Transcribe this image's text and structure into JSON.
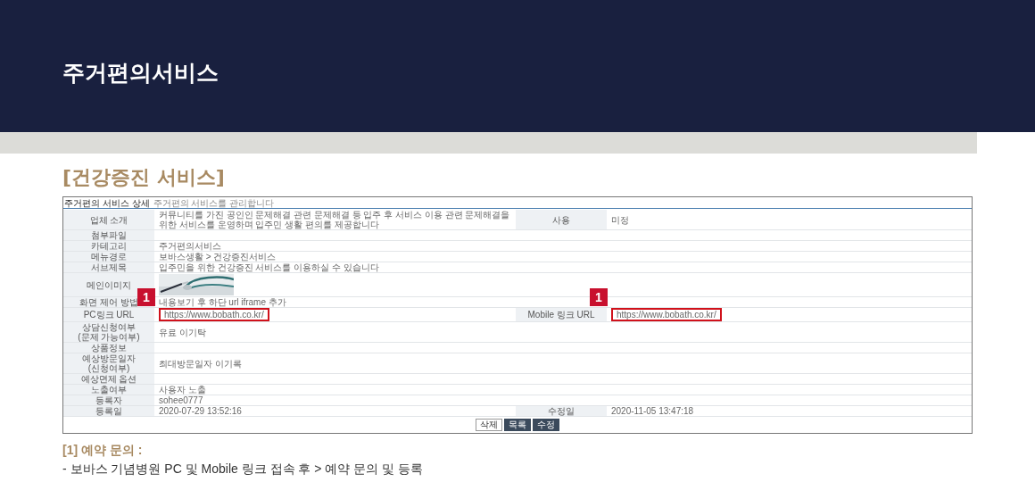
{
  "page_title": "주거편의서비스",
  "section_title": "[건강증진 서비스]",
  "screenshot": {
    "title": "주거편의 서비스 상세",
    "subtitle": "주거편의 서비스를 관리합니다",
    "rows": [
      {
        "kind": "text",
        "label": "업체 소개",
        "value": "커뮤니티를 가진 공인인 문제해결 관련 문제해결 등 입주 후 서비스 이용 관련 문제해결을 위한 서비스를 운영하며 입주민 생활 편의를 제공합니다",
        "right": {
          "label": "사용",
          "value": "미정"
        }
      },
      {
        "kind": "text",
        "label": "첨부파일",
        "value": ""
      },
      {
        "kind": "text",
        "label": "카테고리",
        "value": "주거편의서비스"
      },
      {
        "kind": "text",
        "label": "메뉴경로",
        "value": "보바스생활 > 건강증진서비스"
      },
      {
        "kind": "text",
        "label": "서브제목",
        "value": "입주민을 위한 건강증진 서비스를 이용하실 수 있습니다"
      },
      {
        "label": "메인이미지"
      },
      {
        "kind": "text",
        "label": "화면 제어 방법",
        "value": "내용보기 후 하단 url iframe 추가"
      },
      {
        "kind": "link",
        "label": "PC링크 URL",
        "value": "https://www.bobath.co.kr/",
        "marker": "1",
        "right": {
          "label": "Mobile 링크 URL",
          "value": "https://www.bobath.co.kr/",
          "marker": "1"
        }
      },
      {
        "kind": "text",
        "label": "상담신청여부\n(문제 가능여부)",
        "value": "유료 이기탁"
      },
      {
        "kind": "text",
        "label": "상품정보",
        "value": ""
      },
      {
        "kind": "text",
        "label": "예상방문일자\n(신청여부)",
        "value": "최대방문일자 이기록"
      },
      {
        "kind": "text",
        "label": "예상면제 옵션",
        "value": ""
      },
      {
        "kind": "text",
        "label": "노출여부",
        "value": "사용자 노출"
      },
      {
        "kind": "text",
        "label": "등록자",
        "value": "sohee0777"
      },
      {
        "kind": "text",
        "label": "등록일",
        "value": "2020-07-29 13:52:16",
        "right": {
          "label": "수정일",
          "value": "2020-11-05 13:47:18"
        }
      }
    ],
    "buttons": [
      {
        "label": "삭제",
        "kind": "plain"
      },
      {
        "label": "목록",
        "kind": "dark"
      },
      {
        "label": "수정",
        "kind": "dark"
      }
    ]
  },
  "note": {
    "title": "[1] 예약 문의 :",
    "text": "- 보바스 기념병원 PC 및 Mobile 링크 접속 후 > 예약 문의 및 등록"
  }
}
